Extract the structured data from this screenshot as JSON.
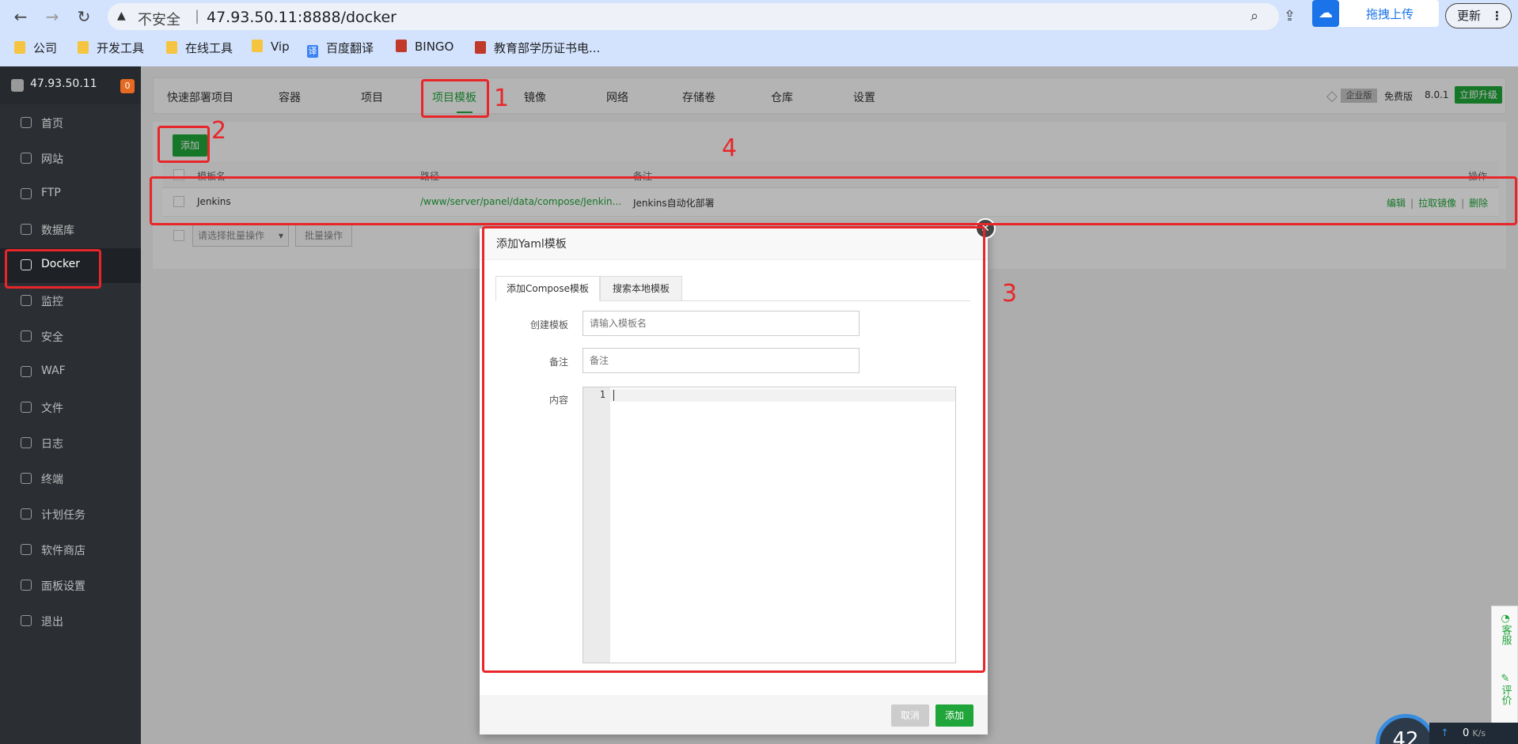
{
  "browser": {
    "insecure_label": "不安全",
    "separator": "|",
    "url": "47.93.50.11:8888/docker",
    "extension_label": "拖拽上传",
    "update_label": "更新",
    "bookmarks": [
      {
        "label": "公司"
      },
      {
        "label": "开发工具"
      },
      {
        "label": "在线工具"
      },
      {
        "label": "Vip"
      },
      {
        "label": "百度翻译"
      },
      {
        "label": "BINGO"
      },
      {
        "label": "教育部学历证书电..."
      }
    ]
  },
  "sidebar": {
    "server_ip": "47.93.50.11",
    "badge_count": "0",
    "items": [
      {
        "label": "首页"
      },
      {
        "label": "网站"
      },
      {
        "label": "FTP"
      },
      {
        "label": "数据库"
      },
      {
        "label": "Docker"
      },
      {
        "label": "监控"
      },
      {
        "label": "安全"
      },
      {
        "label": "WAF"
      },
      {
        "label": "文件"
      },
      {
        "label": "日志"
      },
      {
        "label": "终端"
      },
      {
        "label": "计划任务"
      },
      {
        "label": "软件商店"
      },
      {
        "label": "面板设置"
      },
      {
        "label": "退出"
      }
    ],
    "active_item": "Docker"
  },
  "tabs": [
    {
      "label": "快速部署项目"
    },
    {
      "label": "容器"
    },
    {
      "label": "项目"
    },
    {
      "label": "项目模板"
    },
    {
      "label": "镜像"
    },
    {
      "label": "网络"
    },
    {
      "label": "存储卷"
    },
    {
      "label": "仓库"
    },
    {
      "label": "设置"
    }
  ],
  "active_tab": "项目模板",
  "version": {
    "edition_tag": "企业版",
    "plan": "免费版",
    "number": "8.0.1",
    "upgrade_label": "立即升级"
  },
  "toolbar": {
    "add_label": "添加"
  },
  "table": {
    "columns": [
      "模板名",
      "路径",
      "备注",
      "操作"
    ],
    "rows": [
      {
        "name": "Jenkins",
        "path": "/www/server/panel/data/compose/Jenkin...",
        "remark": "Jenkins自动化部署",
        "actions": [
          "编辑",
          "拉取镜像",
          "删除"
        ]
      }
    ]
  },
  "bulk": {
    "select_placeholder": "请选择批量操作",
    "button_label": "批量操作"
  },
  "modal": {
    "title": "添加Yaml模板",
    "tabs": [
      "添加Compose模板",
      "搜索本地模板"
    ],
    "fields": {
      "name_label": "创建模板",
      "name_placeholder": "请输入模板名",
      "remark_label": "备注",
      "remark_placeholder": "备注",
      "content_label": "内容"
    },
    "editor_line": "1",
    "cancel_label": "取消",
    "submit_label": "添加"
  },
  "annotations": [
    "1",
    "2",
    "3",
    "4"
  ],
  "float_widgets": {
    "service_label": "客服",
    "rate_label": "评价",
    "gauge_value": "42",
    "net_value": "0",
    "net_unit": "K/s"
  },
  "colors": {
    "accent": "#20a53a",
    "annotation": "#e8262a",
    "sidebar_bg": "#2b2f34"
  }
}
